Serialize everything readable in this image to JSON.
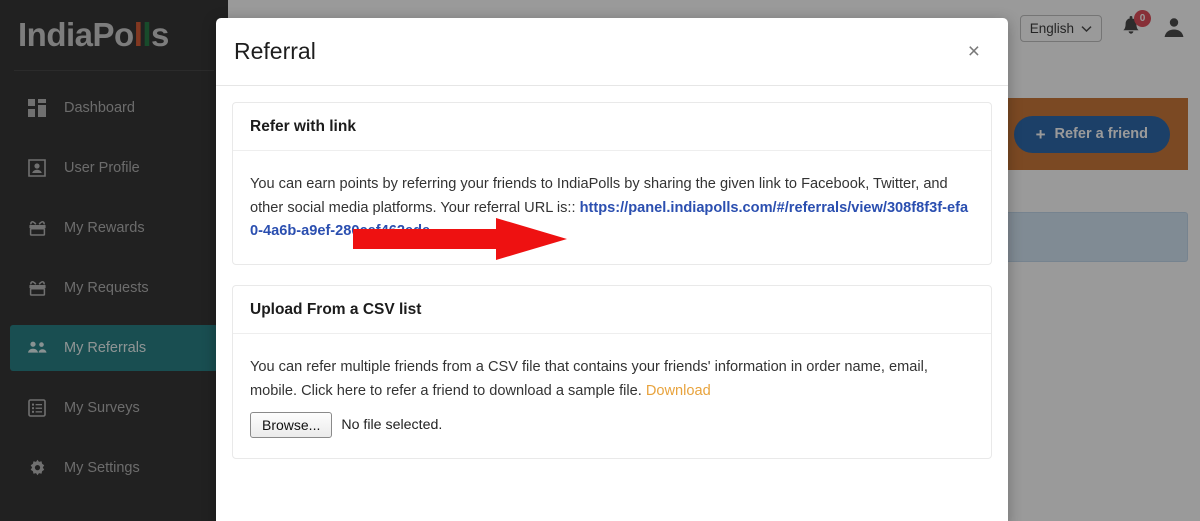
{
  "brand": {
    "logo_part1": "IndiaPo",
    "logo_l_orange": "l",
    "logo_l_green": "l",
    "logo_part2": "s"
  },
  "sidebar": {
    "items": [
      {
        "label": "Dashboard",
        "icon": "grid-icon",
        "active": false
      },
      {
        "label": "User Profile",
        "icon": "user-icon",
        "active": false
      },
      {
        "label": "My Rewards",
        "icon": "gift-icon",
        "active": false
      },
      {
        "label": "My Requests",
        "icon": "gift-icon",
        "active": false
      },
      {
        "label": "My Referrals",
        "icon": "people-icon",
        "active": true
      },
      {
        "label": "My Surveys",
        "icon": "list-icon",
        "active": false
      },
      {
        "label": "My Settings",
        "icon": "gear-icon",
        "active": false
      }
    ]
  },
  "topbar": {
    "language": "English",
    "language_caret": "chevron-down-icon",
    "notification_icon": "bell-icon",
    "notification_count": "0",
    "avatar_icon": "user-avatar-icon"
  },
  "page": {
    "refer_friend_button": "Refer a friend",
    "refer_friend_plus": "+"
  },
  "modal": {
    "title": "Referral",
    "close_label": "×",
    "link_card": {
      "heading": "Refer with link",
      "text_before": "You can earn points by referring your friends to IndiaPolls by sharing the given link to Facebook, Twitter, and other social media platforms. Your referral URL is:: ",
      "url": "https://panel.indiapolls.com/#/referrals/view/308f8f3f-efa0-4a6b-a9ef-280cef462ede",
      "text_after": "."
    },
    "csv_card": {
      "heading": "Upload From a CSV list",
      "text_before": "You can refer multiple friends from a CSV file that contains your friends' information in order name, email, mobile. Click here to refer a friend to download a sample file. ",
      "download_label": "Download",
      "browse_label": "Browse...",
      "file_status": "No file selected."
    }
  },
  "colors": {
    "sidebar_bg": "#1b1b1b",
    "active_teal": "#0d7076",
    "banner_orange": "#c4661f",
    "primary_blue": "#1255a0",
    "link_blue": "#2b4fb0",
    "download_orange": "#e8a33d",
    "badge_red": "#dc3545",
    "annotation_red": "#ee1111"
  },
  "annotation": {
    "shape": "red-arrow-right"
  }
}
